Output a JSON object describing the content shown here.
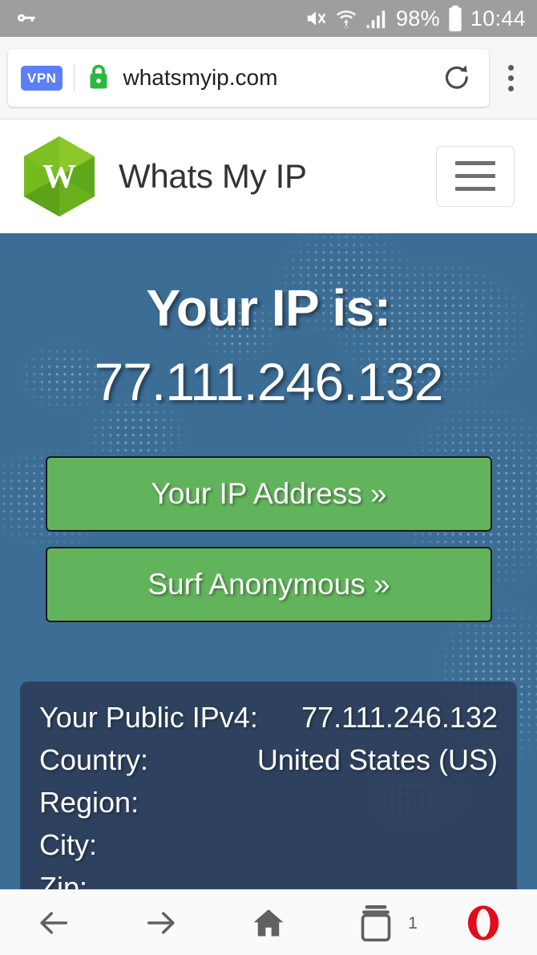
{
  "status_bar": {
    "vpn_icon": "key-icon",
    "icons": [
      "volume-muted-icon",
      "wifi-icon",
      "cellular-signal-icon",
      "battery-icon"
    ],
    "battery_percent": "98%",
    "time": "10:44"
  },
  "browser": {
    "vpn_badge": "VPN",
    "security_icon": "lock-icon",
    "url": "whatsmyip.com",
    "reload_icon": "reload-icon",
    "menu_icon": "kebab-menu-icon"
  },
  "site_header": {
    "logo_letter": "W",
    "logo_icon": "gem-logo-icon",
    "title": "Whats My IP",
    "menu_icon": "hamburger-icon"
  },
  "hero": {
    "heading": "Your IP is:",
    "ip_address": "77.111.246.132",
    "buttons": [
      {
        "label": "Your IP Address »"
      },
      {
        "label": "Surf Anonymous »"
      }
    ]
  },
  "info_panel": {
    "rows": [
      {
        "label": "Your Public IPv4:",
        "value": "77.111.246.132"
      },
      {
        "label": "Country:",
        "value": "United States (US)"
      },
      {
        "label": "Region:",
        "value": ""
      },
      {
        "label": "City:",
        "value": ""
      },
      {
        "label": "Zip:",
        "value": ""
      }
    ]
  },
  "bottom_nav": {
    "items": [
      {
        "name": "back-icon"
      },
      {
        "name": "forward-icon"
      },
      {
        "name": "home-icon"
      },
      {
        "name": "tabs-icon"
      },
      {
        "name": "opera-logo-icon"
      }
    ],
    "tab_count": "1"
  },
  "colors": {
    "status_bar": "#9e9e9e",
    "hero_background": "#3c6d95",
    "button_green": "#62b45c",
    "logo_green": "#72bb1f",
    "lock_green": "#2cb742",
    "vpn_blue": "#5b7ff5",
    "info_panel": "#2c3c58",
    "opera_red": "#e10d1a"
  }
}
